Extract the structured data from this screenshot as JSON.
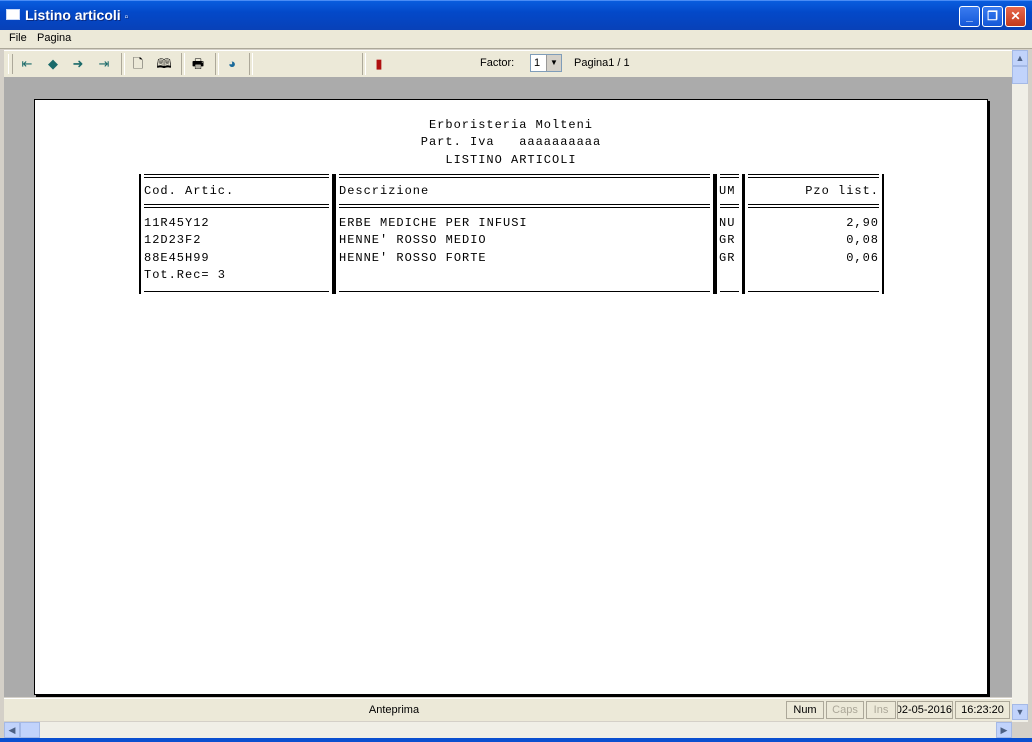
{
  "window": {
    "title": "Listino articoli",
    "title_suffix": "▫"
  },
  "menu": [
    {
      "label": "File"
    },
    {
      "label": "Pagina"
    }
  ],
  "toolbar": {
    "factor_label": "Factor:",
    "factor_value": "1",
    "page_info": "Pagina1 / 1"
  },
  "report": {
    "company": "Erboristeria Molteni",
    "vat": "Part. Iva   aaaaaaaaaa",
    "title": "LISTINO ARTICOLI",
    "headers": {
      "code": "Cod. Artic.",
      "desc": "Descrizione",
      "um": "UM",
      "price": "Pzo list."
    },
    "rows": [
      {
        "code": "11R45Y12",
        "desc": "ERBE MEDICHE PER INFUSI",
        "um": "NU",
        "price": "2,90"
      },
      {
        "code": "12D23F2",
        "desc": "HENNE' ROSSO MEDIO",
        "um": "GR",
        "price": "0,08"
      },
      {
        "code": "88E45H99",
        "desc": "HENNE' ROSSO FORTE",
        "um": "GR",
        "price": "0,06"
      }
    ],
    "total": "Tot.Rec= 3"
  },
  "status": {
    "main": "Anteprima",
    "num": "Num",
    "caps": "Caps",
    "ins": "Ins",
    "date": "02-05-2016",
    "time": "16:23:20"
  }
}
